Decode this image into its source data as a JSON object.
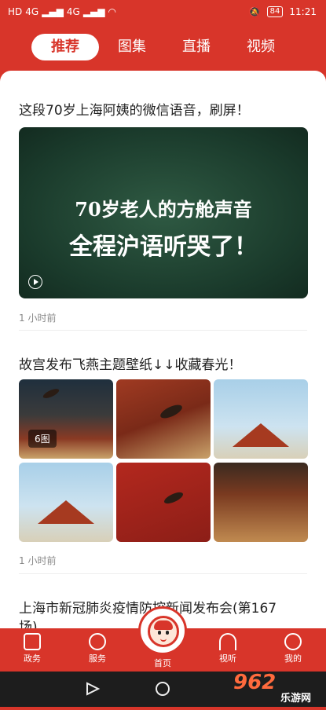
{
  "status_bar": {
    "left_indicators": [
      "HD",
      "4G",
      "4G"
    ],
    "battery": "84",
    "time": "11:21"
  },
  "top_tabs": [
    {
      "label": "推荐",
      "active": true
    },
    {
      "label": "图集",
      "active": false
    },
    {
      "label": "直播",
      "active": false
    },
    {
      "label": "视频",
      "active": false
    }
  ],
  "feed": [
    {
      "title": "这段70岁上海阿姨的微信语音，刷屏！",
      "video_line1": "70岁老人的方舱声音",
      "video_line2": "全程沪语听哭了！",
      "time": "1 小时前"
    },
    {
      "title": "故宫发布飞燕主题壁纸↓↓收藏春光！",
      "image_count": "6图",
      "time": "1 小时前"
    },
    {
      "title": "上海市新冠肺炎疫情防控新闻发布会(第167",
      "title_cont": "场)"
    }
  ],
  "bottom_nav": [
    {
      "label": "政务",
      "icon": "clipboard-icon"
    },
    {
      "label": "服务",
      "icon": "service-icon"
    },
    {
      "label": "首页",
      "icon": "mascot-icon"
    },
    {
      "label": "视听",
      "icon": "sun-broadcast-icon"
    },
    {
      "label": "我的",
      "icon": "user-icon"
    }
  ],
  "watermark": {
    "brand": "962",
    "sub": "乐游网"
  },
  "colors": {
    "brand": "#d8352a",
    "text": "#222222",
    "muted": "#888888"
  }
}
